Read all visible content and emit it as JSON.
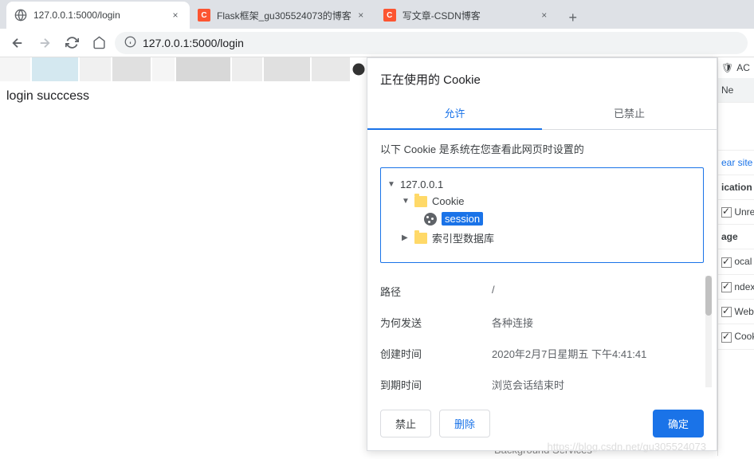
{
  "tabs": [
    {
      "title": "127.0.0.1:5000/login",
      "type": "globe"
    },
    {
      "title": "Flask框架_gu305524073的博客",
      "type": "csdn"
    },
    {
      "title": "写文章-CSDN博客",
      "type": "csdn"
    }
  ],
  "address": {
    "url": "127.0.0.1:5000/login"
  },
  "page": {
    "body_text": "login succcess"
  },
  "dialog": {
    "title": "正在使用的 Cookie",
    "tab_allow": "允许",
    "tab_block": "已禁止",
    "description": "以下 Cookie 是系统在您查看此网页时设置的",
    "tree": {
      "host": "127.0.0.1",
      "cookie_folder": "Cookie",
      "cookie_name": "session",
      "indexed_db": "索引型数据库"
    },
    "details": {
      "path_label": "路径",
      "path_value": "/",
      "reason_label": "为何发送",
      "reason_value": "各种连接",
      "created_label": "创建时间",
      "created_value": "2020年2月7日星期五 下午4:41:41",
      "expires_label": "到期时间",
      "expires_value": "浏览会话结束时"
    },
    "btn_block": "禁止",
    "btn_delete": "删除",
    "btn_ok": "确定"
  },
  "right": {
    "top1": "AC",
    "top2": "Ne",
    "clear": "ear site",
    "h1": "ication",
    "i1": "Unregis",
    "h2": "age",
    "i2": "ocal a",
    "i3": "ndexec",
    "i4": "Web S(",
    "i5": "Cookie",
    "bg": "Background Services"
  },
  "watermark": "https://blog.csdn.net/gu305524073"
}
